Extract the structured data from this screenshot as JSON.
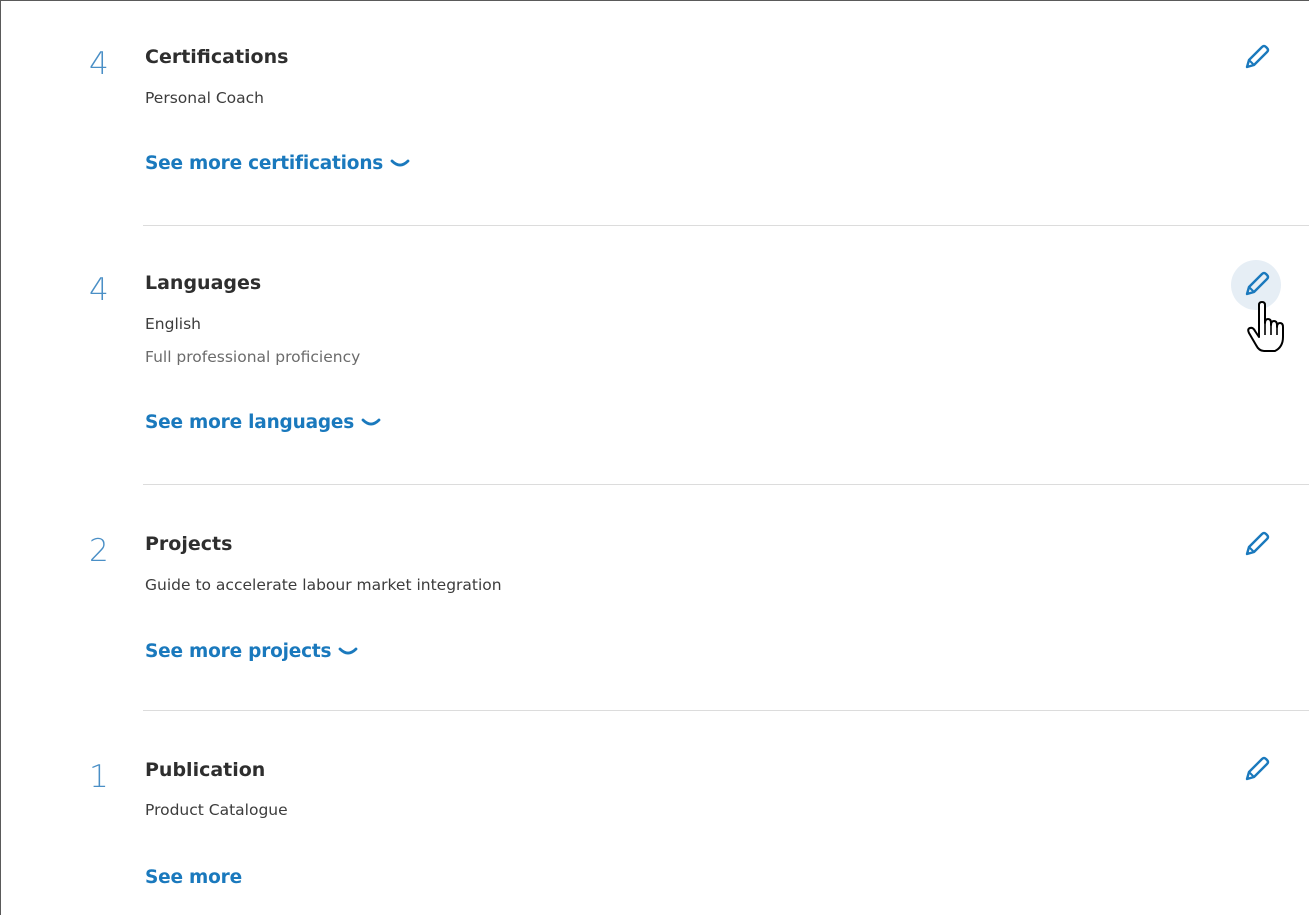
{
  "sections": [
    {
      "count": "4",
      "title": "Certifications",
      "line1": "Personal Coach",
      "line2": "",
      "see_more": "See more certifications",
      "has_chevron": true
    },
    {
      "count": "4",
      "title": "Languages",
      "line1": "English",
      "line2": "Full professional proficiency",
      "see_more": "See more languages",
      "has_chevron": true
    },
    {
      "count": "2",
      "title": "Projects",
      "line1": "Guide to accelerate labour market integration",
      "line2": "",
      "see_more": "See more projects",
      "has_chevron": true
    },
    {
      "count": "1",
      "title": "Publication",
      "line1": "Product Catalogue",
      "line2": "",
      "see_more": "See more",
      "has_chevron": false
    }
  ],
  "icons": {
    "edit": "pencil-icon",
    "chevron": "chevron-down-icon",
    "cursor": "hand-pointer-cursor"
  },
  "colors": {
    "count": "#4a8fc6",
    "link": "#1a79bd",
    "title": "#2e2e2e",
    "hover_bg": "#e6eef5"
  }
}
